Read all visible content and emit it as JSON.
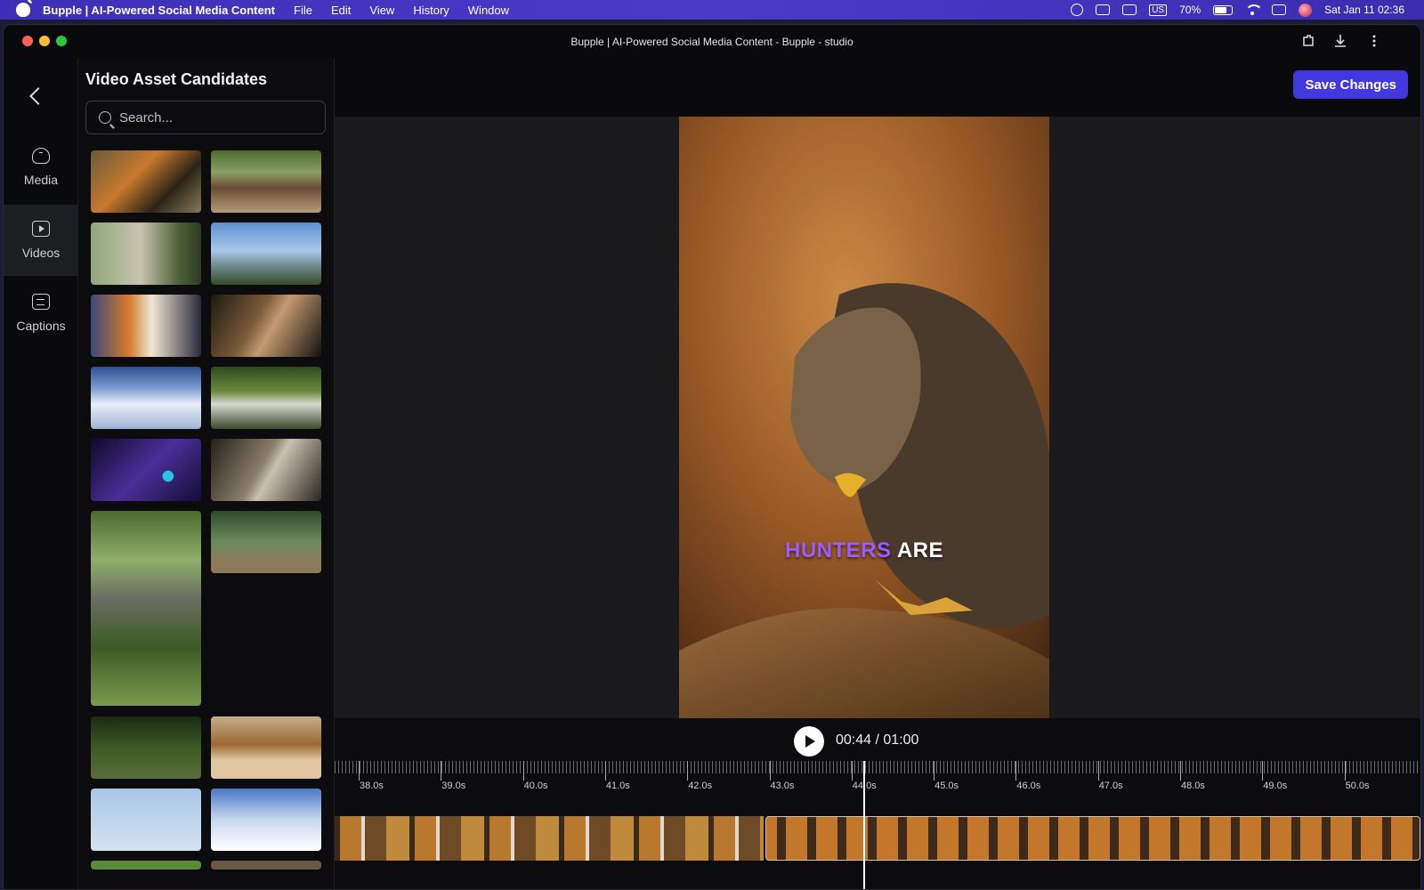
{
  "menubar": {
    "app_name": "Bupple | AI-Powered Social Media Content",
    "items": [
      "File",
      "Edit",
      "View",
      "History",
      "Window"
    ],
    "input_source": "US",
    "battery": "70%",
    "clock": "Sat Jan 11  02:36"
  },
  "window": {
    "title": "Bupple | AI-Powered Social Media Content - Bupple - studio"
  },
  "rail": {
    "items": [
      {
        "label": "Media",
        "icon": "cloud-upload-icon"
      },
      {
        "label": "Videos",
        "icon": "video-icon",
        "active": true
      },
      {
        "label": "Captions",
        "icon": "captions-icon"
      }
    ]
  },
  "panel": {
    "title": "Video Asset Candidates",
    "search_placeholder": "Search...",
    "thumbnails": [
      "tiger-walking",
      "hedge-wall",
      "motion-blur-tiger",
      "birds-sky",
      "tiger-portrait",
      "wolf-howl",
      "cloud-cumulus",
      "geese-stones",
      "space-particles",
      "wolf-lying",
      "cat-in-plants",
      "wolf-forest",
      "forest-trunk",
      "lion-resting",
      "sky-birds",
      "clouds-above"
    ]
  },
  "toolbar": {
    "save_label": "Save Changes"
  },
  "preview": {
    "caption_highlight": "HUNTERS",
    "caption_rest": "ARE",
    "highlight_color": "#9b5cff"
  },
  "playback": {
    "time": "00:44 / 01:00",
    "ticks": [
      "38.0s",
      "39.0s",
      "40.0s",
      "41.0s",
      "42.0s",
      "43.0s",
      "44.0s",
      "45.0s",
      "46.0s",
      "47.0s",
      "48.0s",
      "49.0s",
      "50.0s"
    ],
    "accent": "#4238e0"
  }
}
